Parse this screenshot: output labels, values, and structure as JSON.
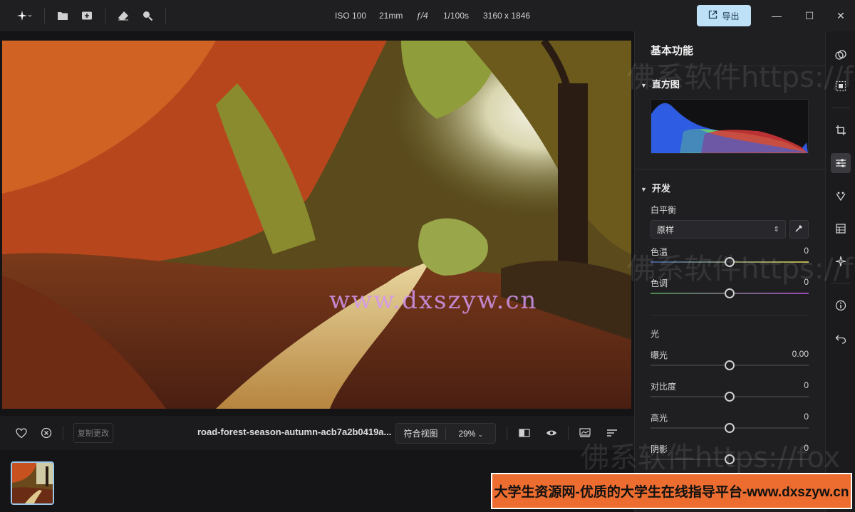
{
  "topbar": {
    "logo_icon": "sparkle-icon",
    "meta": {
      "iso": "ISO 100",
      "focal": "21mm",
      "aperture": "ƒ/4",
      "shutter": "1/100s",
      "dimensions": "3160 x 1846"
    },
    "export_label": "导出",
    "window": {
      "minimize": "—",
      "maximize": "☐",
      "close": "✕"
    }
  },
  "bottombar": {
    "revert_label": "复制更改",
    "filename": "road-forest-season-autumn-acb7a2b0419a...",
    "fit_label": "符合视图",
    "zoom_label": "29%"
  },
  "panel": {
    "title": "基本功能",
    "histogram_label": "直方图",
    "develop_label": "开发",
    "white_balance_label": "白平衡",
    "white_balance_value": "原样",
    "sliders_wb": [
      {
        "label": "色温",
        "value": "0",
        "level": 0.5
      },
      {
        "label": "色调",
        "value": "0",
        "level": 0.5
      }
    ],
    "light_label": "光",
    "sliders_light": [
      {
        "label": "曝光",
        "value": "0.00",
        "level": 0.5
      },
      {
        "label": "对比度",
        "value": "0",
        "level": 0.5
      },
      {
        "label": "高光",
        "value": "0",
        "level": 0.5
      },
      {
        "label": "阴影",
        "value": "0",
        "level": 0.5
      }
    ]
  },
  "watermark": {
    "overlay_text": "佛系软件https://fox",
    "site_text": "www.dxszyw.cn",
    "banner_text": "大学生资源网-优质的大学生在线指导平台-www.dxszyw.cn"
  },
  "colors": {
    "accent": "#bfe1f7",
    "banner": "#ec6d2f",
    "histogram_blue": "#2f5fe8",
    "histogram_green": "#6fd36a",
    "histogram_red": "#d8383a"
  }
}
